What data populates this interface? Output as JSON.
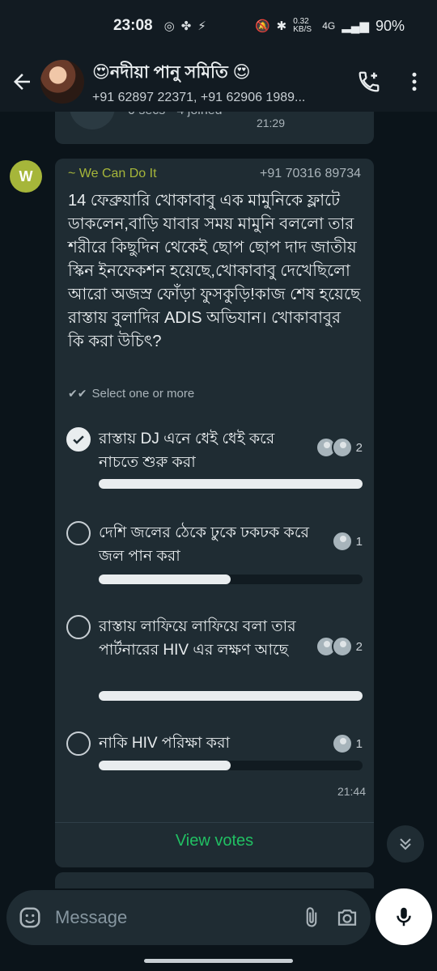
{
  "status_bar": {
    "time": "23:08",
    "speed": "0.32 KB/S",
    "network": "4G",
    "battery": "90%"
  },
  "header": {
    "group_name": "😍নদীয়া পানু সমিতি 😍",
    "members": "+91 62897 22371, +91 62906 1989..."
  },
  "previous_message": {
    "info": "0 secs · 4 joined",
    "time": "21:29"
  },
  "poll": {
    "avatar_letter": "W",
    "sender_name": "~ We Can Do It",
    "sender_phone": "+91 70316 89734",
    "question": "14 ফেব্রুয়ারি খোকাবাবু এক মামুনিকে ফ্লাটে ডাকলেন,বাড়ি যাবার সময় মামুনি বললো তার শরীরে কিছুদিন থেকেই ছোপ ছোপ দাদ জাতীয় স্কিন ইনফেকশন হয়েছে,খোকাবাবু দেখেছিলো আরো অজস্র ফোঁড়া ফুসকুড়ি!কাজ শেষ হয়েছে রাস্তায় বুলাদির ADIS অভিযান। খোকাবাবুর কি করা উচিৎ?",
    "select_hint": "Select one or more",
    "options": [
      {
        "text": "রাস্তায় DJ এনে ধেই ধেই করে নাচতে শুরু করা",
        "votes": "2",
        "fraction": 1.0,
        "checked": true
      },
      {
        "text": "দেশি জলের ঠেকে ঢুকে ঢকঢক করে জল পান করা",
        "votes": "1",
        "fraction": 0.5,
        "checked": false
      },
      {
        "text": "রাস্তায় লাফিয়ে লাফিয়ে বলা তার পার্টনারের HIV এর লক্ষণ আছে",
        "votes": "2",
        "fraction": 1.0,
        "checked": false
      },
      {
        "text": "নাকি HIV পরিক্ষা করা",
        "votes": "1",
        "fraction": 0.5,
        "checked": false
      }
    ],
    "time": "21:44",
    "view_votes": "View votes"
  },
  "input": {
    "placeholder": "Message"
  },
  "colors": {
    "accent_green": "#21c063",
    "sender_color": "#a6b63a",
    "bubble": "#1f2c33",
    "background": "#0b141a"
  },
  "icons": [
    "back-arrow-icon",
    "add-call-icon",
    "more-options-icon",
    "check-icon",
    "emoji-icon",
    "attach-icon",
    "camera-icon",
    "mic-icon",
    "scroll-down-icon"
  ]
}
